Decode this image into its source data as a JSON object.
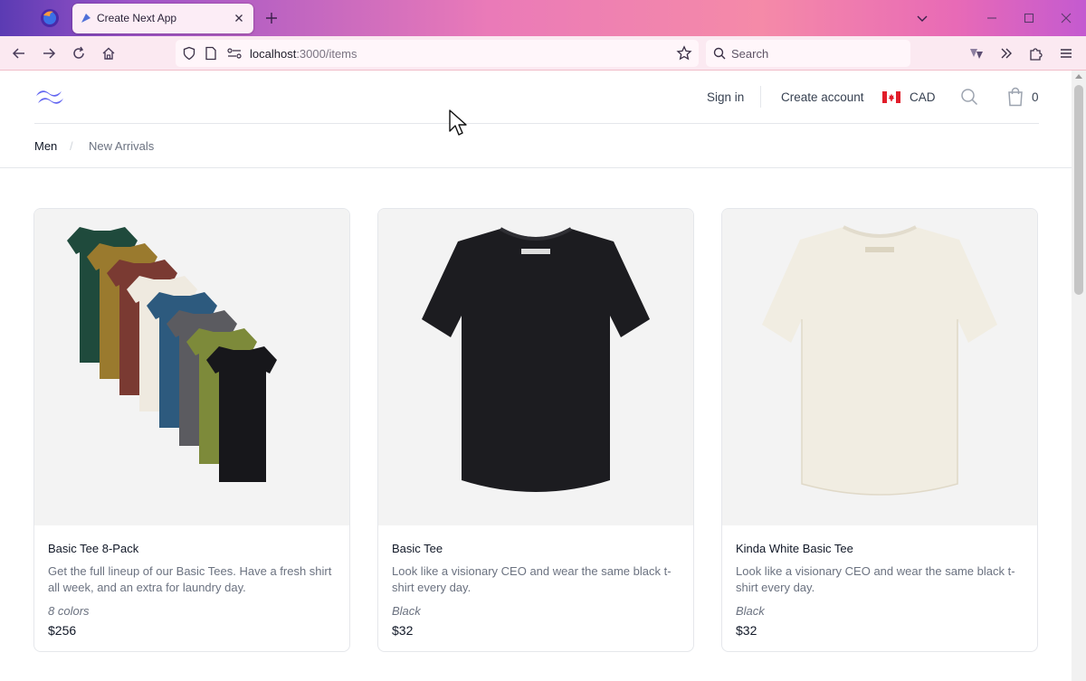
{
  "browser": {
    "tab_title": "Create Next App",
    "url_host": "localhost",
    "url_path": ":3000/items",
    "search_placeholder": "Search"
  },
  "header": {
    "sign_in": "Sign in",
    "create_account": "Create account",
    "currency": "CAD",
    "cart_count": "0"
  },
  "breadcrumb": {
    "items": [
      "Men",
      "New Arrivals"
    ],
    "separator": "/"
  },
  "products": [
    {
      "name": "Basic Tee 8-Pack",
      "description": "Get the full lineup of our Basic Tees. Have a fresh shirt all week, and an extra for laundry day.",
      "variant": "8 colors",
      "price": "$256"
    },
    {
      "name": "Basic Tee",
      "description": "Look like a visionary CEO and wear the same black t-shirt every day.",
      "variant": "Black",
      "price": "$32"
    },
    {
      "name": "Kinda White Basic Tee",
      "description": "Look like a visionary CEO and wear the same black t-shirt every day.",
      "variant": "Black",
      "price": "$32"
    }
  ],
  "colors": {
    "brand": "#6366f1",
    "text_primary": "#111827",
    "text_secondary": "#6b7280"
  }
}
